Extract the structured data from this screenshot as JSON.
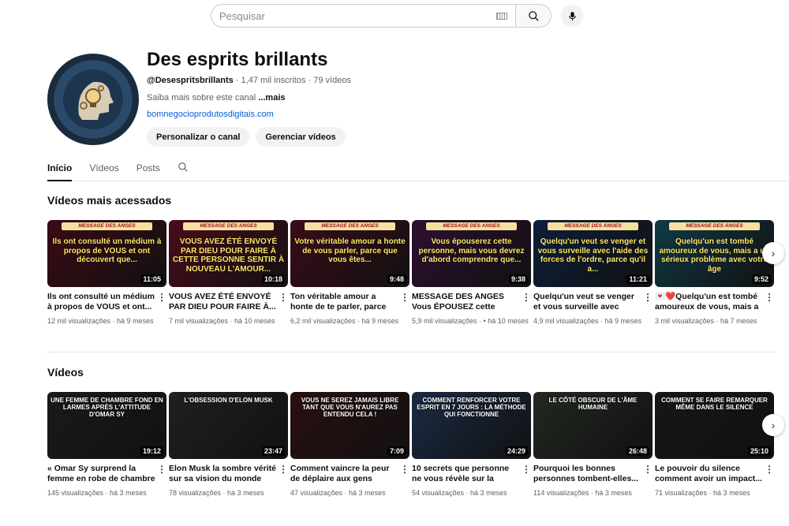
{
  "search": {
    "placeholder": "Pesquisar"
  },
  "channel": {
    "name": "Des esprits brillants",
    "handle": "@Desespritsbrillants",
    "subscribers": "1,47 mil inscritos",
    "videos_count": "79 vídeos",
    "desc": "Saiba mais sobre este canal",
    "desc_more": "...mais",
    "link": "bomnegocioprodutosdigitais.com",
    "btn_customize": "Personalizar o canal",
    "btn_manage": "Gerenciar vídeos"
  },
  "tabs": [
    "Início",
    "Vídeos",
    "Posts"
  ],
  "popular": {
    "title": "Vídeos mais acessados",
    "items": [
      {
        "thumb_text": "Ils ont consulté un médium à propos de VOUS et ont découvert que...",
        "banner": "MESSAGE DES ANGES",
        "duration": "11:05",
        "title": "Ils ont consulté un médium à propos de VOUS et ont...",
        "views": "12 mil visualizações",
        "age": "há 9 meses",
        "bg": "#3a0a14"
      },
      {
        "thumb_text": "VOUS AVEZ ÉTÉ ENVOYÉ PAR DIEU POUR FAIRE À CETTE PERSONNE SENTIR À NOUVEAU L'AMOUR...",
        "banner": "MESSAGE DES ANGES",
        "duration": "10:18",
        "title": "VOUS AVEZ ÉTÉ ENVOYÉ PAR DIEU POUR FAIRE À...",
        "views": "7 mil visualizações",
        "age": "há 10 meses",
        "bg": "#4a0c1c"
      },
      {
        "thumb_text": "Votre véritable amour a honte de vous parler, parce que vous êtes...",
        "banner": "MESSAGE DES ANGES",
        "duration": "9:48",
        "title": "Ton véritable amour a honte de te parler, parce que tu...",
        "views": "6,2 mil visualizações",
        "age": "há 9 meses",
        "bg": "#3b0b18"
      },
      {
        "thumb_text": "Vous épouserez cette personne, mais vous devrez d'abord comprendre que...",
        "banner": "MESSAGE DES ANGES",
        "duration": "9:38",
        "title": "MESSAGE DES ANGES Vous ÉPOUSEZ cette personne,...",
        "views": "5,9 mil visualizações",
        "age": "• há 10 meses",
        "bg": "#2d1030"
      },
      {
        "thumb_text": "Quelqu'un veut se venger et vous surveille avec l'aide des forces de l'ordre, parce qu'il a...",
        "banner": "MESSAGE DES ANGES",
        "duration": "11:21",
        "title": "Quelqu'un veut se venger et vous surveille avec l'aide de...",
        "views": "4,9 mil visualizações",
        "age": "há 9 meses",
        "bg": "#0d1f3a"
      },
      {
        "thumb_text": "Quelqu'un est tombé amoureux de vous, mais a un sérieux problème avec votre âge",
        "banner": "MESSAGE DES ANGES",
        "duration": "9:52",
        "title": "💌❤️Quelqu'un est tombé amoureux de vous, mais a u...",
        "views": "3 mil visualizações",
        "age": "há 7 meses",
        "bg": "#0f3a45"
      }
    ]
  },
  "videos": {
    "title": "Vídeos",
    "items": [
      {
        "thumb_text": "UNE FEMME DE CHAMBRE FOND EN LARMES APRÈS L'ATTITUDE D'OMAR SY",
        "duration": "19:12",
        "title": "« Omar Sy surprend la femme en robe de chambre par un...",
        "views": "145 visualizações",
        "age": "há 3 meses",
        "bg": "#1a1a1a"
      },
      {
        "thumb_text": "L'OBSESSION D'ELON MUSK",
        "duration": "23:47",
        "title": "Elon Musk la sombre vérité sur sa vision du monde",
        "views": "78 visualizações",
        "age": "há 3 meses",
        "bg": "#202020"
      },
      {
        "thumb_text": "VOUS NE SEREZ JAMAIS LIBRE TANT QUE VOUS N'AUREZ PAS ENTENDU CELA !",
        "duration": "7:09",
        "title": "Comment vaincre la peur de déplaire aux gens",
        "views": "47 visualizações",
        "age": "há 3 meses",
        "bg": "#2a0f10"
      },
      {
        "thumb_text": "COMMENT RENFORCER VOTRE ESPRIT EN 7 JOURS : LA MÉTHODE QUI FONCTIONNE",
        "duration": "24:29",
        "title": "10 secrets que personne ne vous révèle sur la capacité ...",
        "views": "54 visualizações",
        "age": "há 3 meses",
        "bg": "#1a2a44"
      },
      {
        "thumb_text": "LE CÔTÉ OBSCUR DE L'ÂME HUMAINE",
        "duration": "26:48",
        "title": "Pourquoi les bonnes personnes tombent-elles...",
        "views": "114 visualizações",
        "age": "há 3 meses",
        "bg": "#222820"
      },
      {
        "thumb_text": "COMMENT SE FAIRE REMARQUER MÊME DANS LE SILENCE",
        "duration": "25:10",
        "title": "Le pouvoir du silence comment avoir un impact...",
        "views": "71 visualizações",
        "age": "há 3 meses",
        "bg": "#161616"
      }
    ]
  }
}
